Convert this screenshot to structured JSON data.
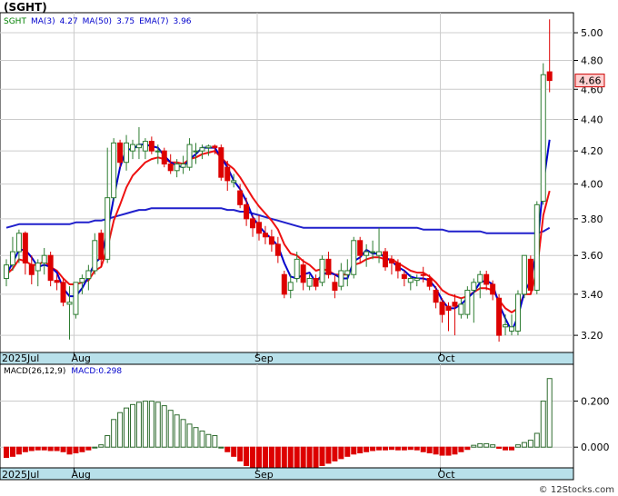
{
  "page_title": "(SGHT)",
  "price_panel": {
    "legend": [
      {
        "label": "SGHT",
        "color": "#008000"
      },
      {
        "label": "MA(3)",
        "color": "#0000cc"
      },
      {
        "label": "4.27",
        "color": "#0000cc"
      },
      {
        "label": "MA(50)",
        "color": "#0000cc"
      },
      {
        "label": "3.75",
        "color": "#0000cc"
      },
      {
        "label": "EMA(7)",
        "color": "#0000cc"
      },
      {
        "label": "3.96",
        "color": "#0000cc"
      }
    ],
    "last_price_label": "4.66",
    "y_ticks": [
      "5.00",
      "4.80",
      "4.60",
      "4.40",
      "4.20",
      "4.00",
      "3.80",
      "3.60",
      "3.40",
      "3.20"
    ]
  },
  "x_axis": {
    "labels": [
      "2025Jul",
      "Aug",
      "Sep",
      "Oct"
    ]
  },
  "macd_panel": {
    "legend": [
      {
        "label": "MACD(26,12,9)",
        "color": "#000000"
      },
      {
        "label": "MACD:0.298",
        "color": "#0000cc"
      }
    ],
    "y_ticks": [
      "0.200",
      "0.000"
    ]
  },
  "watermark": "© 12Stocks.com",
  "colors": {
    "up": "#2e7d32",
    "down": "#dd0000",
    "ma_blue": "#0000cc",
    "ma_red": "#ee1111",
    "axis_band": "#b8e0ea",
    "grid": "#cccccc"
  },
  "chart_data": [
    {
      "type": "candlestick",
      "title": "(SGHT)",
      "ylim": [
        3.12,
        5.15
      ],
      "y_ticks": [
        5.0,
        4.8,
        4.6,
        4.4,
        4.2,
        4.0,
        3.8,
        3.6,
        3.4,
        3.2
      ],
      "y_scale": "log",
      "grid": true,
      "last_price": 4.66,
      "candles": [
        {
          "o": 3.48,
          "h": 3.58,
          "l": 3.44,
          "c": 3.55,
          "d": "up"
        },
        {
          "o": 3.55,
          "h": 3.7,
          "l": 3.52,
          "c": 3.62,
          "d": "up"
        },
        {
          "o": 3.62,
          "h": 3.74,
          "l": 3.56,
          "c": 3.72,
          "d": "up"
        },
        {
          "o": 3.72,
          "h": 3.73,
          "l": 3.5,
          "c": 3.56,
          "d": "down"
        },
        {
          "o": 3.55,
          "h": 3.6,
          "l": 3.45,
          "c": 3.5,
          "d": "down"
        },
        {
          "o": 3.52,
          "h": 3.58,
          "l": 3.44,
          "c": 3.56,
          "d": "up"
        },
        {
          "o": 3.56,
          "h": 3.64,
          "l": 3.5,
          "c": 3.6,
          "d": "up"
        },
        {
          "o": 3.6,
          "h": 3.62,
          "l": 3.44,
          "c": 3.47,
          "d": "down"
        },
        {
          "o": 3.47,
          "h": 3.5,
          "l": 3.42,
          "c": 3.46,
          "d": "down"
        },
        {
          "o": 3.46,
          "h": 3.48,
          "l": 3.34,
          "c": 3.36,
          "d": "down"
        },
        {
          "o": 3.35,
          "h": 3.44,
          "l": 3.18,
          "c": 3.36,
          "d": "up"
        },
        {
          "o": 3.3,
          "h": 3.46,
          "l": 3.28,
          "c": 3.46,
          "d": "up"
        },
        {
          "o": 3.46,
          "h": 3.5,
          "l": 3.4,
          "c": 3.48,
          "d": "up"
        },
        {
          "o": 3.48,
          "h": 3.55,
          "l": 3.42,
          "c": 3.52,
          "d": "up"
        },
        {
          "o": 3.52,
          "h": 3.72,
          "l": 3.5,
          "c": 3.68,
          "d": "up"
        },
        {
          "o": 3.72,
          "h": 3.74,
          "l": 3.54,
          "c": 3.58,
          "d": "down"
        },
        {
          "o": 3.58,
          "h": 4.22,
          "l": 3.56,
          "c": 3.92,
          "d": "up"
        },
        {
          "o": 3.92,
          "h": 4.28,
          "l": 3.9,
          "c": 4.25,
          "d": "up"
        },
        {
          "o": 4.25,
          "h": 4.27,
          "l": 4.1,
          "c": 4.13,
          "d": "down"
        },
        {
          "o": 4.13,
          "h": 4.3,
          "l": 4.08,
          "c": 4.25,
          "d": "up"
        },
        {
          "o": 4.2,
          "h": 4.27,
          "l": 4.15,
          "c": 4.24,
          "d": "up"
        },
        {
          "o": 4.24,
          "h": 4.35,
          "l": 4.15,
          "c": 4.22,
          "d": "up"
        },
        {
          "o": 4.2,
          "h": 4.28,
          "l": 4.15,
          "c": 4.26,
          "d": "up"
        },
        {
          "o": 4.26,
          "h": 4.29,
          "l": 4.18,
          "c": 4.2,
          "d": "down"
        },
        {
          "o": 4.2,
          "h": 4.24,
          "l": 4.12,
          "c": 4.2,
          "d": "up"
        },
        {
          "o": 4.2,
          "h": 4.22,
          "l": 4.1,
          "c": 4.12,
          "d": "down"
        },
        {
          "o": 4.12,
          "h": 4.18,
          "l": 4.06,
          "c": 4.08,
          "d": "down"
        },
        {
          "o": 4.08,
          "h": 4.15,
          "l": 4.04,
          "c": 4.12,
          "d": "up"
        },
        {
          "o": 4.12,
          "h": 4.17,
          "l": 4.06,
          "c": 4.1,
          "d": "up"
        },
        {
          "o": 4.1,
          "h": 4.28,
          "l": 4.08,
          "c": 4.24,
          "d": "up"
        },
        {
          "o": 4.2,
          "h": 4.25,
          "l": 4.12,
          "c": 4.2,
          "d": "up"
        },
        {
          "o": 4.2,
          "h": 4.24,
          "l": 4.15,
          "c": 4.22,
          "d": "up"
        },
        {
          "o": 4.22,
          "h": 4.24,
          "l": 4.17,
          "c": 4.23,
          "d": "up"
        },
        {
          "o": 4.23,
          "h": 4.24,
          "l": 4.18,
          "c": 4.22,
          "d": "down"
        },
        {
          "o": 4.22,
          "h": 4.24,
          "l": 4.02,
          "c": 4.04,
          "d": "down"
        },
        {
          "o": 4.1,
          "h": 4.14,
          "l": 3.96,
          "c": 4.02,
          "d": "down"
        },
        {
          "o": 4.02,
          "h": 4.06,
          "l": 3.98,
          "c": 4.01,
          "d": "up"
        },
        {
          "o": 3.96,
          "h": 4.0,
          "l": 3.86,
          "c": 3.88,
          "d": "down"
        },
        {
          "o": 3.88,
          "h": 3.92,
          "l": 3.76,
          "c": 3.8,
          "d": "down"
        },
        {
          "o": 3.8,
          "h": 3.82,
          "l": 3.7,
          "c": 3.75,
          "d": "down"
        },
        {
          "o": 3.78,
          "h": 3.82,
          "l": 3.68,
          "c": 3.72,
          "d": "down"
        },
        {
          "o": 3.72,
          "h": 3.76,
          "l": 3.66,
          "c": 3.7,
          "d": "down"
        },
        {
          "o": 3.7,
          "h": 3.74,
          "l": 3.62,
          "c": 3.66,
          "d": "down"
        },
        {
          "o": 3.66,
          "h": 3.7,
          "l": 3.56,
          "c": 3.6,
          "d": "down"
        },
        {
          "o": 3.5,
          "h": 3.52,
          "l": 3.38,
          "c": 3.4,
          "d": "down"
        },
        {
          "o": 3.42,
          "h": 3.5,
          "l": 3.38,
          "c": 3.46,
          "d": "up"
        },
        {
          "o": 3.48,
          "h": 3.62,
          "l": 3.46,
          "c": 3.58,
          "d": "up"
        },
        {
          "o": 3.55,
          "h": 3.58,
          "l": 3.42,
          "c": 3.46,
          "d": "down"
        },
        {
          "o": 3.44,
          "h": 3.5,
          "l": 3.42,
          "c": 3.48,
          "d": "up"
        },
        {
          "o": 3.48,
          "h": 3.5,
          "l": 3.42,
          "c": 3.44,
          "d": "down"
        },
        {
          "o": 3.46,
          "h": 3.6,
          "l": 3.44,
          "c": 3.58,
          "d": "up"
        },
        {
          "o": 3.58,
          "h": 3.62,
          "l": 3.48,
          "c": 3.5,
          "d": "down"
        },
        {
          "o": 3.46,
          "h": 3.5,
          "l": 3.38,
          "c": 3.42,
          "d": "down"
        },
        {
          "o": 3.44,
          "h": 3.56,
          "l": 3.42,
          "c": 3.52,
          "d": "up"
        },
        {
          "o": 3.52,
          "h": 3.58,
          "l": 3.44,
          "c": 3.5,
          "d": "up"
        },
        {
          "o": 3.5,
          "h": 3.7,
          "l": 3.48,
          "c": 3.68,
          "d": "up"
        },
        {
          "o": 3.68,
          "h": 3.7,
          "l": 3.56,
          "c": 3.6,
          "d": "down"
        },
        {
          "o": 3.6,
          "h": 3.66,
          "l": 3.54,
          "c": 3.62,
          "d": "up"
        },
        {
          "o": 3.62,
          "h": 3.68,
          "l": 3.58,
          "c": 3.62,
          "d": "up"
        },
        {
          "o": 3.62,
          "h": 3.75,
          "l": 3.56,
          "c": 3.6,
          "d": "up"
        },
        {
          "o": 3.62,
          "h": 3.64,
          "l": 3.52,
          "c": 3.54,
          "d": "down"
        },
        {
          "o": 3.58,
          "h": 3.6,
          "l": 3.5,
          "c": 3.56,
          "d": "down"
        },
        {
          "o": 3.56,
          "h": 3.58,
          "l": 3.48,
          "c": 3.52,
          "d": "down"
        },
        {
          "o": 3.5,
          "h": 3.52,
          "l": 3.44,
          "c": 3.48,
          "d": "down"
        },
        {
          "o": 3.46,
          "h": 3.5,
          "l": 3.42,
          "c": 3.48,
          "d": "up"
        },
        {
          "o": 3.48,
          "h": 3.5,
          "l": 3.44,
          "c": 3.47,
          "d": "up"
        },
        {
          "o": 3.5,
          "h": 3.54,
          "l": 3.46,
          "c": 3.5,
          "d": "down"
        },
        {
          "o": 3.48,
          "h": 3.5,
          "l": 3.42,
          "c": 3.44,
          "d": "down"
        },
        {
          "o": 3.42,
          "h": 3.44,
          "l": 3.33,
          "c": 3.36,
          "d": "down"
        },
        {
          "o": 3.36,
          "h": 3.38,
          "l": 3.26,
          "c": 3.3,
          "d": "down"
        },
        {
          "o": 3.32,
          "h": 3.36,
          "l": 3.22,
          "c": 3.34,
          "d": "down"
        },
        {
          "o": 3.34,
          "h": 3.4,
          "l": 3.2,
          "c": 3.36,
          "d": "down"
        },
        {
          "o": 3.3,
          "h": 3.38,
          "l": 3.28,
          "c": 3.35,
          "d": "up"
        },
        {
          "o": 3.3,
          "h": 3.44,
          "l": 3.28,
          "c": 3.42,
          "d": "up"
        },
        {
          "o": 3.42,
          "h": 3.48,
          "l": 3.26,
          "c": 3.46,
          "d": "up"
        },
        {
          "o": 3.46,
          "h": 3.52,
          "l": 3.38,
          "c": 3.5,
          "d": "up"
        },
        {
          "o": 3.5,
          "h": 3.52,
          "l": 3.42,
          "c": 3.45,
          "d": "down"
        },
        {
          "o": 3.45,
          "h": 3.47,
          "l": 3.37,
          "c": 3.4,
          "d": "down"
        },
        {
          "o": 3.38,
          "h": 3.4,
          "l": 3.17,
          "c": 3.2,
          "d": "down"
        },
        {
          "o": 3.24,
          "h": 3.3,
          "l": 3.2,
          "c": 3.25,
          "d": "up"
        },
        {
          "o": 3.24,
          "h": 3.3,
          "l": 3.2,
          "c": 3.22,
          "d": "up"
        },
        {
          "o": 3.22,
          "h": 3.42,
          "l": 3.2,
          "c": 3.4,
          "d": "up"
        },
        {
          "o": 3.4,
          "h": 3.6,
          "l": 3.38,
          "c": 3.6,
          "d": "up"
        },
        {
          "o": 3.58,
          "h": 3.6,
          "l": 3.4,
          "c": 3.42,
          "d": "down"
        },
        {
          "o": 3.42,
          "h": 3.9,
          "l": 3.4,
          "c": 3.88,
          "d": "up"
        },
        {
          "o": 3.9,
          "h": 4.78,
          "l": 3.88,
          "c": 4.7,
          "d": "up"
        },
        {
          "o": 4.72,
          "h": 5.1,
          "l": 4.58,
          "c": 4.66,
          "d": "down"
        }
      ],
      "series": [
        {
          "name": "MA(3)",
          "color": "#0000cc",
          "values": [
            3.5,
            3.56,
            3.63,
            3.63,
            3.59,
            3.54,
            3.55,
            3.54,
            3.51,
            3.43,
            3.39,
            3.39,
            3.43,
            3.49,
            3.56,
            3.59,
            3.73,
            3.92,
            4.1,
            4.21,
            4.21,
            4.24,
            4.24,
            4.23,
            4.22,
            4.17,
            4.13,
            4.11,
            4.1,
            4.15,
            4.18,
            4.22,
            4.22,
            4.22,
            4.16,
            4.1,
            4.02,
            3.97,
            3.9,
            3.81,
            3.76,
            3.72,
            3.69,
            3.65,
            3.56,
            3.49,
            3.48,
            3.5,
            3.51,
            3.46,
            3.5,
            3.51,
            3.5,
            3.48,
            3.48,
            3.57,
            3.59,
            3.63,
            3.61,
            3.61,
            3.59,
            3.57,
            3.54,
            3.52,
            3.49,
            3.48,
            3.48,
            3.47,
            3.43,
            3.37,
            3.33,
            3.33,
            3.35,
            3.38,
            3.41,
            3.46,
            3.47,
            3.45,
            3.35,
            3.28,
            3.22,
            3.29,
            3.41,
            3.47,
            3.63,
            4.0,
            4.27
          ]
        },
        {
          "name": "EMA(7)",
          "color": "#ee1111",
          "values": [
            3.5,
            3.53,
            3.58,
            3.57,
            3.55,
            3.55,
            3.57,
            3.54,
            3.52,
            3.48,
            3.45,
            3.45,
            3.46,
            3.47,
            3.52,
            3.54,
            3.64,
            3.79,
            3.88,
            3.98,
            4.05,
            4.09,
            4.13,
            4.15,
            4.16,
            4.15,
            4.13,
            4.13,
            4.12,
            4.15,
            4.16,
            4.18,
            4.19,
            4.2,
            4.16,
            4.12,
            4.09,
            4.04,
            3.98,
            3.92,
            3.87,
            3.83,
            3.79,
            3.74,
            3.66,
            3.61,
            3.6,
            3.57,
            3.55,
            3.52,
            3.53,
            3.52,
            3.5,
            3.5,
            3.5,
            3.55,
            3.56,
            3.58,
            3.59,
            3.59,
            3.58,
            3.58,
            3.56,
            3.54,
            3.52,
            3.51,
            3.51,
            3.49,
            3.46,
            3.42,
            3.4,
            3.39,
            3.38,
            3.39,
            3.41,
            3.43,
            3.43,
            3.42,
            3.37,
            3.33,
            3.31,
            3.33,
            3.4,
            3.4,
            3.52,
            3.82,
            3.96
          ]
        },
        {
          "name": "MA(50)",
          "color": "#2020cc",
          "values": [
            3.75,
            3.76,
            3.77,
            3.77,
            3.77,
            3.77,
            3.77,
            3.77,
            3.77,
            3.77,
            3.77,
            3.78,
            3.78,
            3.78,
            3.79,
            3.79,
            3.8,
            3.81,
            3.82,
            3.83,
            3.84,
            3.85,
            3.85,
            3.86,
            3.86,
            3.86,
            3.86,
            3.86,
            3.86,
            3.86,
            3.86,
            3.86,
            3.86,
            3.86,
            3.86,
            3.85,
            3.85,
            3.84,
            3.84,
            3.83,
            3.82,
            3.81,
            3.8,
            3.79,
            3.78,
            3.77,
            3.76,
            3.75,
            3.75,
            3.75,
            3.75,
            3.75,
            3.75,
            3.75,
            3.75,
            3.75,
            3.75,
            3.75,
            3.75,
            3.75,
            3.75,
            3.75,
            3.75,
            3.75,
            3.75,
            3.75,
            3.74,
            3.74,
            3.74,
            3.74,
            3.73,
            3.73,
            3.73,
            3.73,
            3.73,
            3.73,
            3.72,
            3.72,
            3.72,
            3.72,
            3.72,
            3.72,
            3.72,
            3.72,
            3.72,
            3.73,
            3.75
          ]
        }
      ]
    },
    {
      "type": "bar",
      "title": "MACD(26,12,9)",
      "ylim": [
        -0.09,
        0.36
      ],
      "y_ticks": [
        0.2,
        0.0
      ],
      "macd_value": 0.298,
      "values": [
        -0.045,
        -0.04,
        -0.03,
        -0.02,
        -0.015,
        -0.012,
        -0.012,
        -0.015,
        -0.015,
        -0.02,
        -0.03,
        -0.025,
        -0.02,
        -0.012,
        0.0,
        0.01,
        0.05,
        0.12,
        0.15,
        0.17,
        0.185,
        0.195,
        0.2,
        0.2,
        0.195,
        0.18,
        0.16,
        0.14,
        0.12,
        0.1,
        0.085,
        0.07,
        0.055,
        0.05,
        0.0,
        -0.02,
        -0.04,
        -0.06,
        -0.08,
        -0.1,
        -0.115,
        -0.12,
        -0.13,
        -0.135,
        -0.13,
        -0.125,
        -0.115,
        -0.105,
        -0.095,
        -0.09,
        -0.08,
        -0.07,
        -0.06,
        -0.05,
        -0.04,
        -0.03,
        -0.025,
        -0.02,
        -0.015,
        -0.012,
        -0.012,
        -0.01,
        -0.012,
        -0.012,
        -0.01,
        -0.012,
        -0.02,
        -0.025,
        -0.03,
        -0.035,
        -0.035,
        -0.03,
        -0.02,
        -0.01,
        0.008,
        0.015,
        0.015,
        0.01,
        -0.005,
        -0.012,
        -0.012,
        0.01,
        0.02,
        0.03,
        0.06,
        0.2,
        0.298
      ]
    }
  ]
}
